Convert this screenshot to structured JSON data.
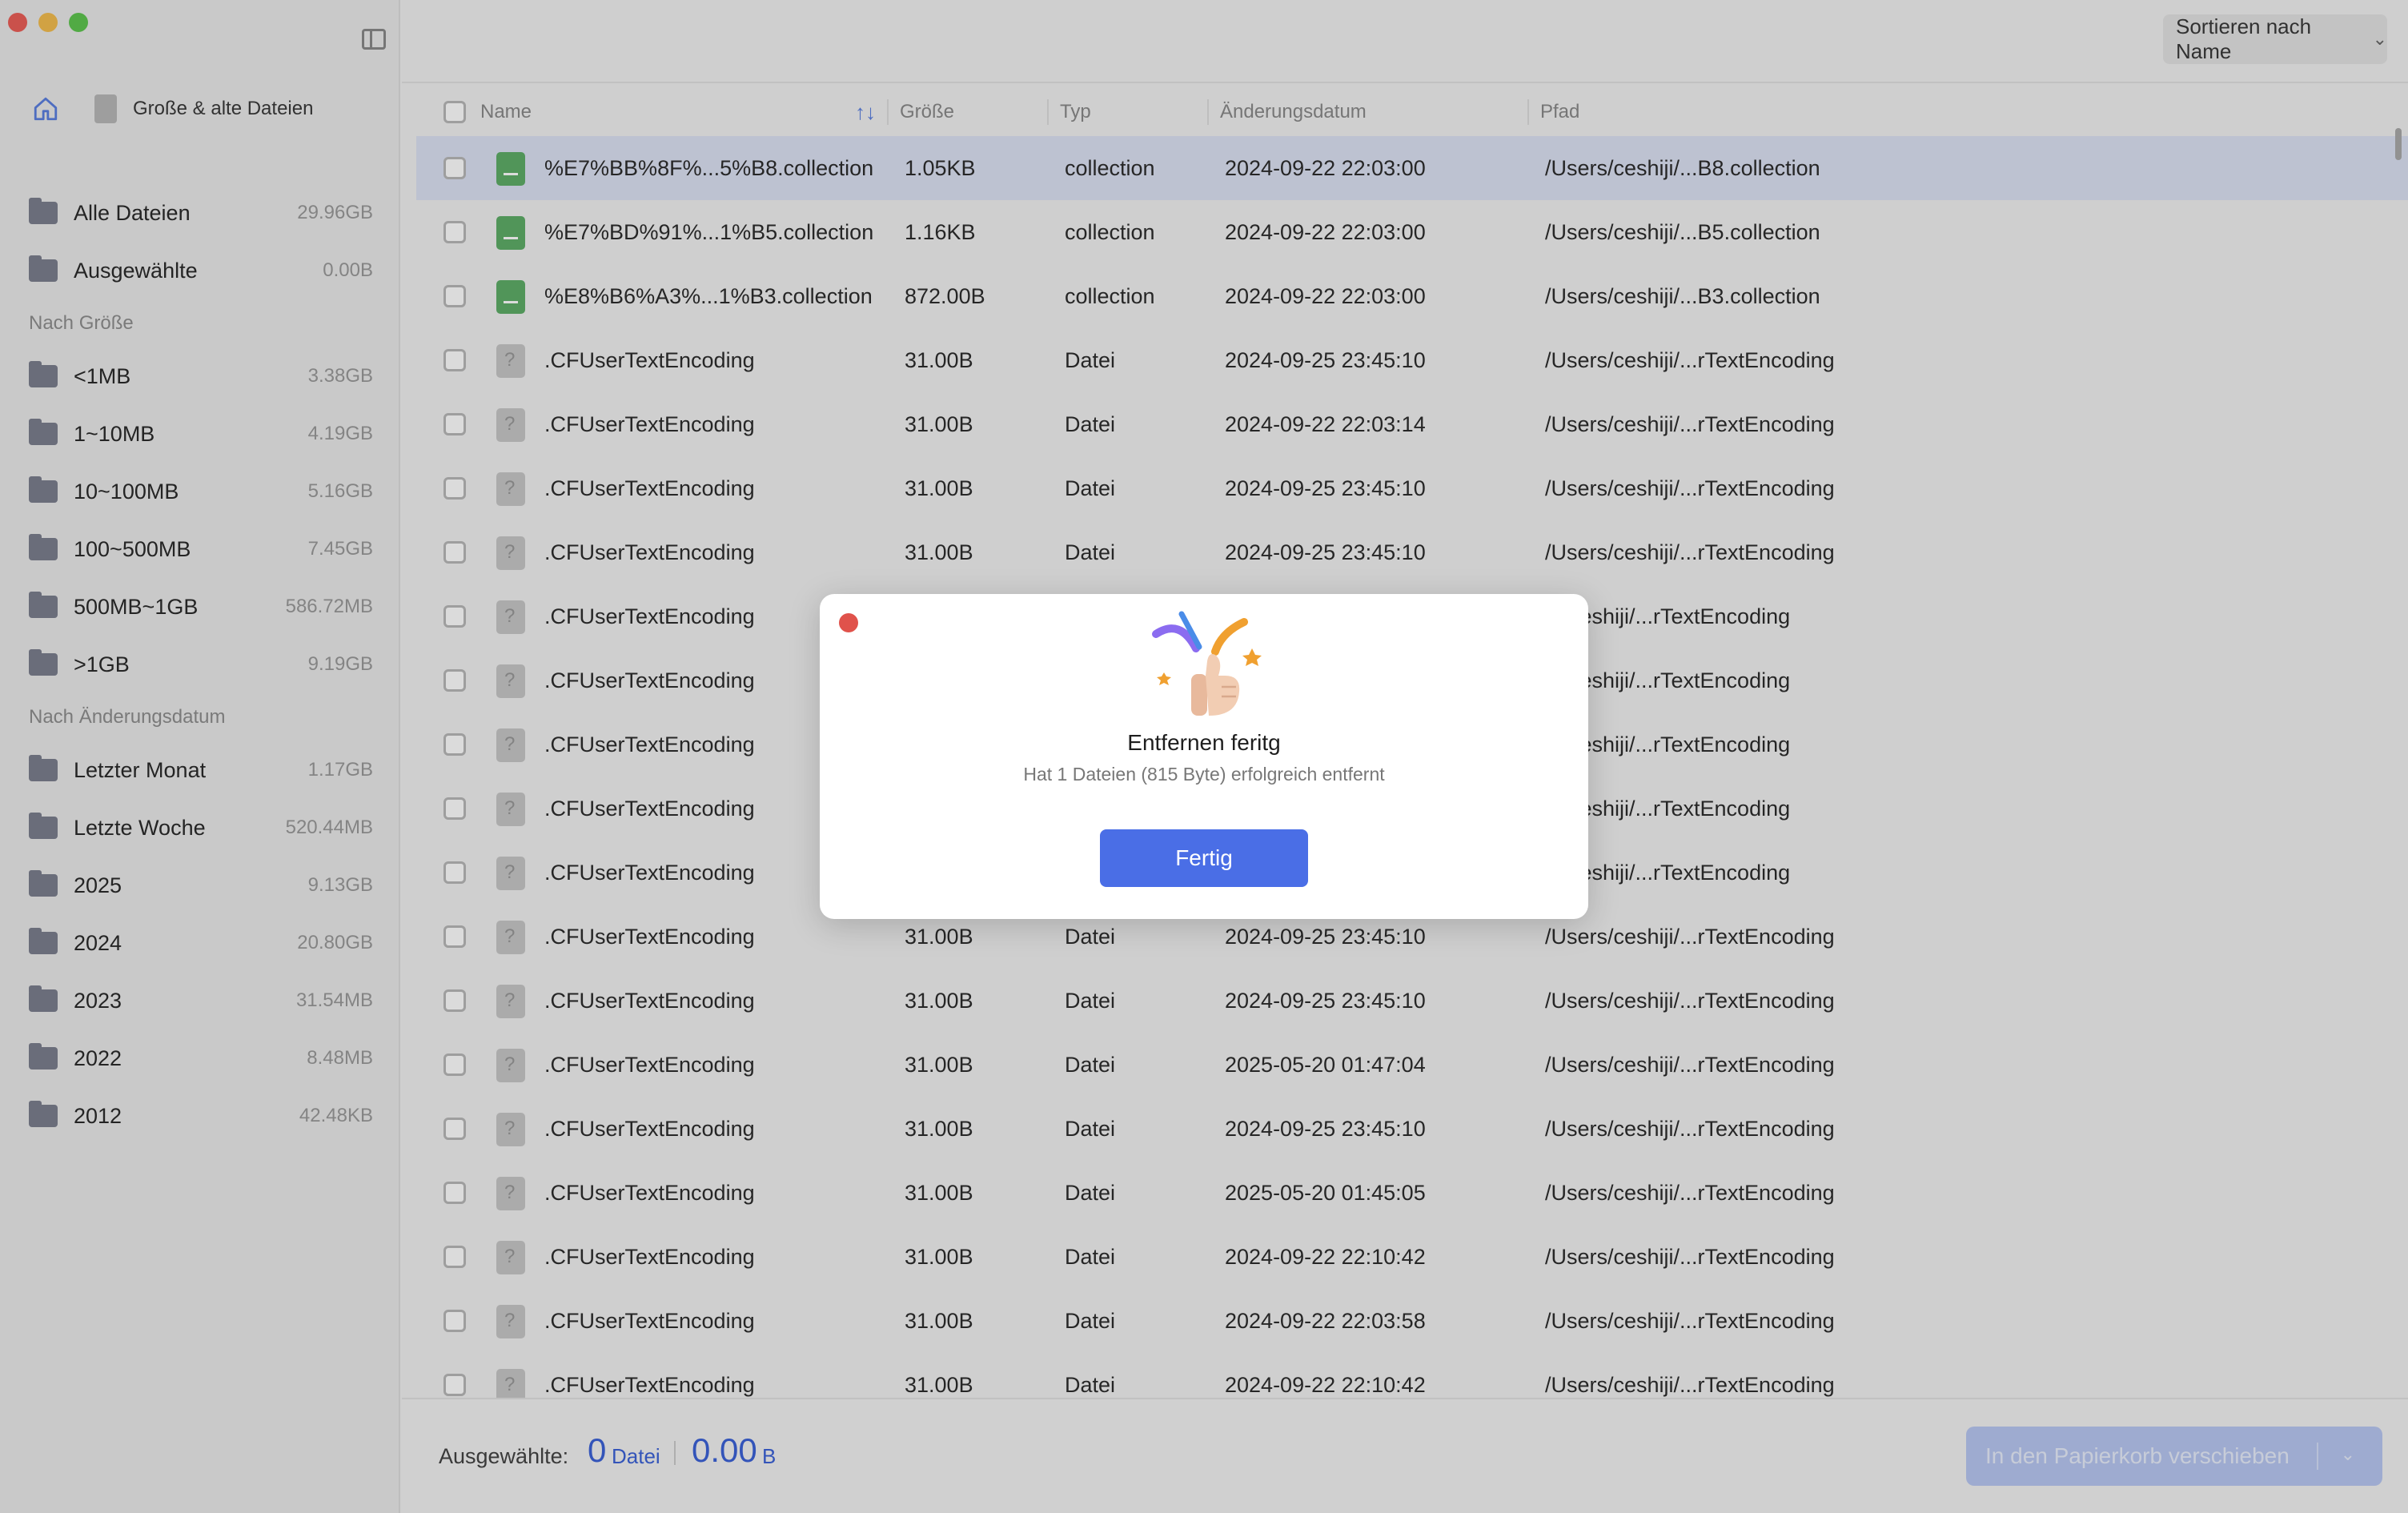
{
  "breadcrumb": {
    "home_icon": "home-icon",
    "label": "Große & alte Dateien"
  },
  "sidebar": {
    "top_items": [
      {
        "label": "Alle Dateien",
        "size": "29.96GB"
      },
      {
        "label": "Ausgewählte",
        "size": "0.00B"
      }
    ],
    "size_heading": "Nach Größe",
    "size_items": [
      {
        "label": "<1MB",
        "size": "3.38GB"
      },
      {
        "label": "1~10MB",
        "size": "4.19GB"
      },
      {
        "label": "10~100MB",
        "size": "5.16GB"
      },
      {
        "label": "100~500MB",
        "size": "7.45GB"
      },
      {
        "label": "500MB~1GB",
        "size": "586.72MB"
      },
      {
        "label": ">1GB",
        "size": "9.19GB"
      }
    ],
    "date_heading": "Nach Änderungsdatum",
    "date_items": [
      {
        "label": "Letzter Monat",
        "size": "1.17GB"
      },
      {
        "label": "Letzte Woche",
        "size": "520.44MB"
      },
      {
        "label": "2025",
        "size": "9.13GB"
      },
      {
        "label": "2024",
        "size": "20.80GB"
      },
      {
        "label": "2023",
        "size": "31.54MB"
      },
      {
        "label": "2022",
        "size": "8.48MB"
      },
      {
        "label": "2012",
        "size": "42.48KB"
      }
    ]
  },
  "toolbar": {
    "sort_label": "Sortieren nach Name"
  },
  "table": {
    "headers": {
      "name": "Name",
      "size": "Größe",
      "type": "Typ",
      "date": "Änderungsdatum",
      "path": "Pfad"
    },
    "rows": [
      {
        "name": "%E7%BB%8F%...5%B8.collection",
        "size": "1.05KB",
        "type": "collection",
        "date": "2024-09-22 22:03:00",
        "path": "/Users/ceshiji/...B8.collection",
        "icon": "green"
      },
      {
        "name": "%E7%BD%91%...1%B5.collection",
        "size": "1.16KB",
        "type": "collection",
        "date": "2024-09-22 22:03:00",
        "path": "/Users/ceshiji/...B5.collection",
        "icon": "green"
      },
      {
        "name": "%E8%B6%A3%...1%B3.collection",
        "size": "872.00B",
        "type": "collection",
        "date": "2024-09-22 22:03:00",
        "path": "/Users/ceshiji/...B3.collection",
        "icon": "green"
      },
      {
        "name": ".CFUserTextEncoding",
        "size": "31.00B",
        "type": "Datei",
        "date": "2024-09-25 23:45:10",
        "path": "/Users/ceshiji/...rTextEncoding",
        "icon": "grey"
      },
      {
        "name": ".CFUserTextEncoding",
        "size": "31.00B",
        "type": "Datei",
        "date": "2024-09-22 22:03:14",
        "path": "/Users/ceshiji/...rTextEncoding",
        "icon": "grey"
      },
      {
        "name": ".CFUserTextEncoding",
        "size": "31.00B",
        "type": "Datei",
        "date": "2024-09-25 23:45:10",
        "path": "/Users/ceshiji/...rTextEncoding",
        "icon": "grey"
      },
      {
        "name": ".CFUserTextEncoding",
        "size": "31.00B",
        "type": "Datei",
        "date": "2024-09-25 23:45:10",
        "path": "/Users/ceshiji/...rTextEncoding",
        "icon": "grey"
      },
      {
        "name": ".CFUserTextEncoding",
        "size": "",
        "type": "",
        "date": "",
        "path": "rs/ceshiji/...rTextEncoding",
        "icon": "grey"
      },
      {
        "name": ".CFUserTextEncoding",
        "size": "",
        "type": "",
        "date": "",
        "path": "rs/ceshiji/...rTextEncoding",
        "icon": "grey"
      },
      {
        "name": ".CFUserTextEncoding",
        "size": "",
        "type": "",
        "date": "",
        "path": "rs/ceshiji/...rTextEncoding",
        "icon": "grey"
      },
      {
        "name": ".CFUserTextEncoding",
        "size": "",
        "type": "",
        "date": "",
        "path": "rs/ceshiji/...rTextEncoding",
        "icon": "grey"
      },
      {
        "name": ".CFUserTextEncoding",
        "size": "",
        "type": "",
        "date": "",
        "path": "rs/ceshiji/...rTextEncoding",
        "icon": "grey"
      },
      {
        "name": ".CFUserTextEncoding",
        "size": "31.00B",
        "type": "Datei",
        "date": "2024-09-25 23:45:10",
        "path": "/Users/ceshiji/...rTextEncoding",
        "icon": "grey"
      },
      {
        "name": ".CFUserTextEncoding",
        "size": "31.00B",
        "type": "Datei",
        "date": "2024-09-25 23:45:10",
        "path": "/Users/ceshiji/...rTextEncoding",
        "icon": "grey"
      },
      {
        "name": ".CFUserTextEncoding",
        "size": "31.00B",
        "type": "Datei",
        "date": "2025-05-20 01:47:04",
        "path": "/Users/ceshiji/...rTextEncoding",
        "icon": "grey"
      },
      {
        "name": ".CFUserTextEncoding",
        "size": "31.00B",
        "type": "Datei",
        "date": "2024-09-25 23:45:10",
        "path": "/Users/ceshiji/...rTextEncoding",
        "icon": "grey"
      },
      {
        "name": ".CFUserTextEncoding",
        "size": "31.00B",
        "type": "Datei",
        "date": "2025-05-20 01:45:05",
        "path": "/Users/ceshiji/...rTextEncoding",
        "icon": "grey"
      },
      {
        "name": ".CFUserTextEncoding",
        "size": "31.00B",
        "type": "Datei",
        "date": "2024-09-22 22:10:42",
        "path": "/Users/ceshiji/...rTextEncoding",
        "icon": "grey"
      },
      {
        "name": ".CFUserTextEncoding",
        "size": "31.00B",
        "type": "Datei",
        "date": "2024-09-22 22:03:58",
        "path": "/Users/ceshiji/...rTextEncoding",
        "icon": "grey"
      },
      {
        "name": ".CFUserTextEncoding",
        "size": "31.00B",
        "type": "Datei",
        "date": "2024-09-22 22:10:42",
        "path": "/Users/ceshiji/...rTextEncoding",
        "icon": "grey"
      }
    ]
  },
  "footer": {
    "selected_label": "Ausgewählte:",
    "count": "0",
    "count_unit": "Datei",
    "size": "0.00",
    "size_unit": "B",
    "trash_button": "In den Papierkorb verschieben"
  },
  "modal": {
    "title": "Entfernen feritg",
    "subtitle": "Hat 1 Dateien (815 Byte) erfolgreich entfernt",
    "button": "Fertig",
    "illustration": "thumbs-up-icon"
  }
}
